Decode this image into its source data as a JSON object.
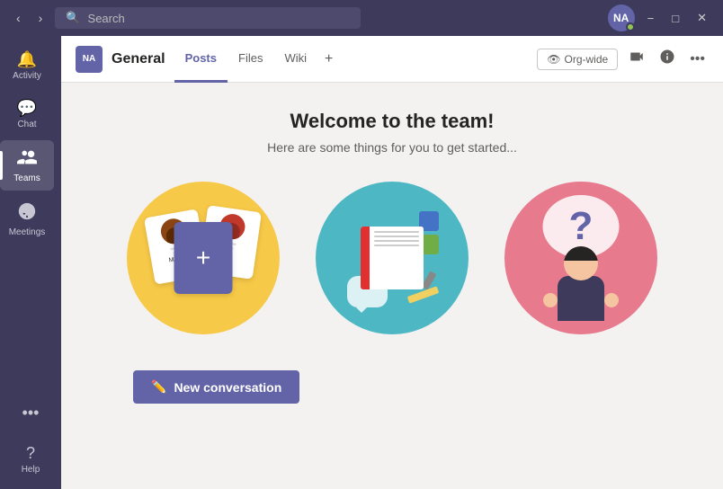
{
  "titlebar": {
    "search_placeholder": "Search",
    "minimize_label": "−",
    "maximize_label": "□",
    "close_label": "✕",
    "avatar_initials": "NA"
  },
  "sidebar": {
    "items": [
      {
        "id": "activity",
        "label": "Activity",
        "icon": "🔔"
      },
      {
        "id": "chat",
        "label": "Chat",
        "icon": "💬"
      },
      {
        "id": "teams",
        "label": "Teams",
        "icon": "👥",
        "active": true
      },
      {
        "id": "meetings",
        "label": "Meetings",
        "icon": "📅"
      }
    ],
    "more_label": "•••",
    "help_label": "Help"
  },
  "channel": {
    "badge": "NA",
    "name": "General",
    "tabs": [
      {
        "id": "posts",
        "label": "Posts",
        "active": true
      },
      {
        "id": "files",
        "label": "Files",
        "active": false
      },
      {
        "id": "wiki",
        "label": "Wiki",
        "active": false
      }
    ],
    "org_wide_label": "Org-wide"
  },
  "main": {
    "welcome_title": "Welcome to the team!",
    "welcome_sub": "Here are some things for you to get started...",
    "new_conv_label": "New conversation",
    "card1_name": "Marine",
    "card2_name": "Ty"
  }
}
